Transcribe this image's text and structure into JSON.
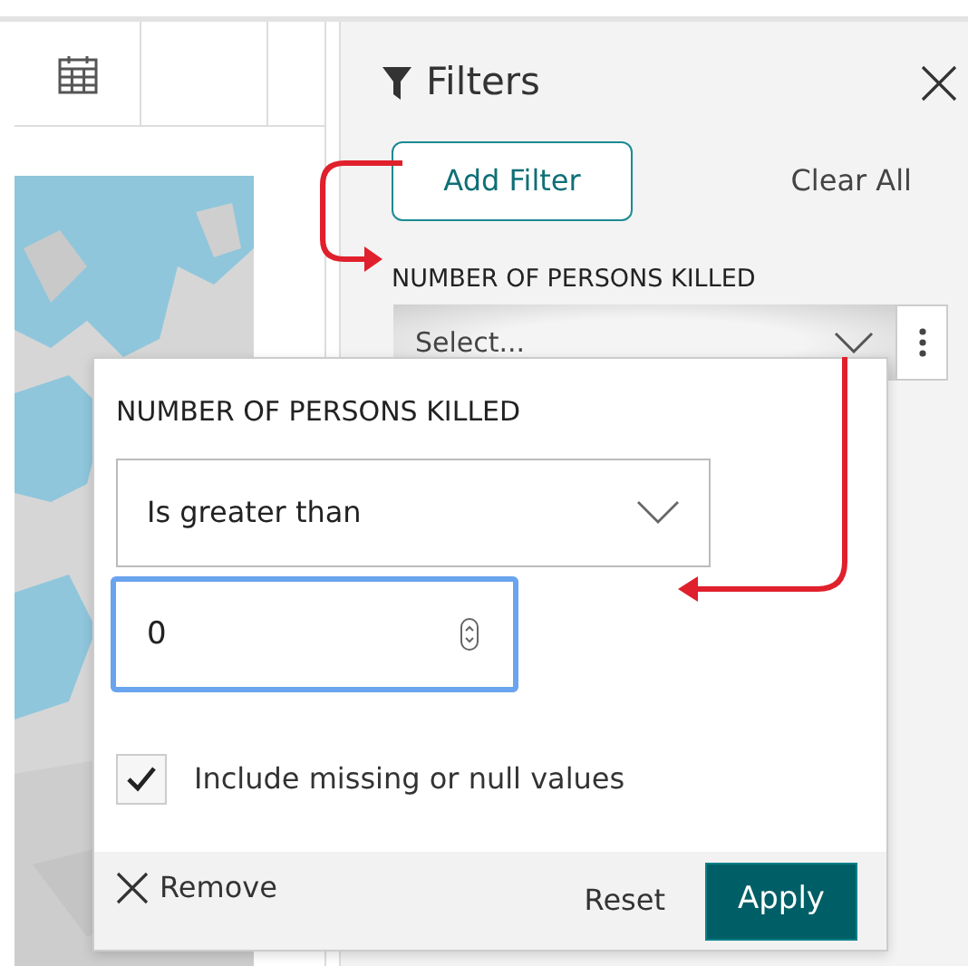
{
  "toolbar": {
    "items": [
      {
        "kind": "calendar"
      },
      {
        "kind": "blank"
      }
    ]
  },
  "filters_panel": {
    "title": "Filters",
    "add_filter": "Add Filter",
    "clear_all": "Clear All",
    "filter": {
      "label": "NUMBER OF PERSONS KILLED",
      "placeholder": "Select..."
    }
  },
  "filter_popup": {
    "label": "NUMBER OF PERSONS KILLED",
    "operator": "Is greater than",
    "value": "0",
    "value_focused": true,
    "include_missing": {
      "label": "Include missing or null values",
      "checked": true
    },
    "remove": "Remove",
    "reset": "Reset",
    "apply": "Apply"
  },
  "annotations": [
    {
      "kind": "arrow-right"
    },
    {
      "kind": "arrow-left"
    }
  ]
}
